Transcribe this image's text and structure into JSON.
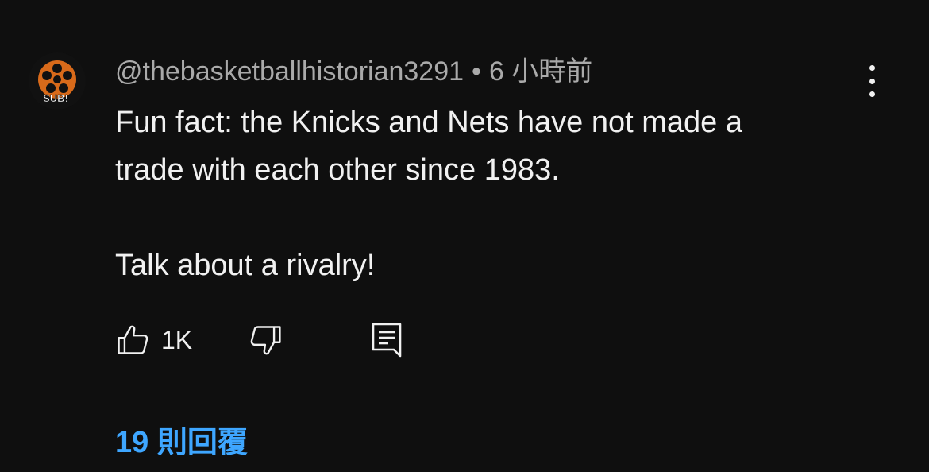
{
  "comment": {
    "author": "@thebasketballhistorian3291",
    "separator": "•",
    "time_ago": "6 小時前",
    "text_lines": [
      "Fun fact: the Knicks and Nets have not made a",
      "trade with each other since 1983."
    ],
    "text_line_2": "Talk about a rivalry!",
    "avatar_text": "SUB!",
    "like_count": "1K",
    "replies_label": "19 則回覆"
  },
  "icons": {
    "avatar": "film-reel-avatar-icon",
    "more": "more-vertical-icon",
    "like": "thumbs-up-icon",
    "dislike": "thumbs-down-icon",
    "reply": "reply-comment-icon"
  },
  "colors": {
    "background": "#0f0f0f",
    "text": "#f1f1f1",
    "meta": "#aaaaaa",
    "link": "#3ea6ff",
    "avatar_accent": "#d86a1a"
  }
}
